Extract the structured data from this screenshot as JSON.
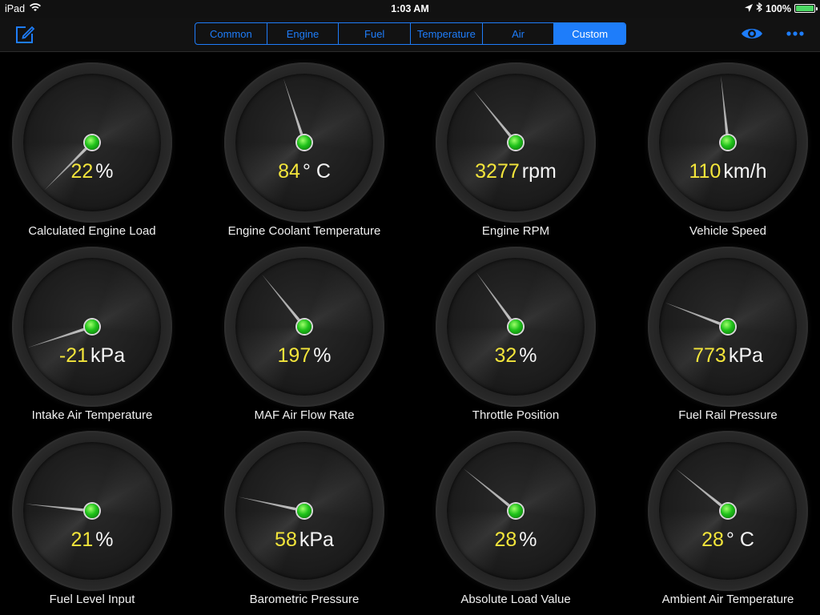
{
  "status_bar": {
    "device": "iPad",
    "time": "1:03 AM",
    "battery": "100%",
    "battery_level": 1.0,
    "icons": [
      "wifi-icon",
      "location-arrow-icon",
      "bluetooth-icon",
      "battery-icon"
    ]
  },
  "nav": {
    "left_icon": "compose-icon",
    "tabs": [
      {
        "label": "Common",
        "selected": false
      },
      {
        "label": "Engine",
        "selected": false
      },
      {
        "label": "Fuel",
        "selected": false
      },
      {
        "label": "Temperature",
        "selected": false
      },
      {
        "label": "Air",
        "selected": false
      },
      {
        "label": "Custom",
        "selected": true
      }
    ],
    "right_icons": [
      "eye-icon",
      "more-icon"
    ],
    "accent_color": "#1e7dfa"
  },
  "colors": {
    "value": "#f3e53b",
    "hub": "#1fc21a"
  },
  "gauges": [
    {
      "label": "Calculated Engine Load",
      "value": "22",
      "unit": "%",
      "needle": 0.05
    },
    {
      "label": "Engine Coolant Temperature",
      "value": "84",
      "unit": "°  C",
      "needle": 0.44
    },
    {
      "label": "Engine RPM",
      "value": "3277",
      "unit": "rpm",
      "needle": 0.37
    },
    {
      "label": "Vehicle Speed",
      "value": "110",
      "unit": "km/h",
      "needle": 0.48
    },
    {
      "label": "Intake Air Temperature",
      "value": "-21",
      "unit": "kPa",
      "needle": 0.14
    },
    {
      "label": "MAF Air Flow Rate",
      "value": "197",
      "unit": "%",
      "needle": 0.37
    },
    {
      "label": "Throttle Position",
      "value": "32",
      "unit": "%",
      "needle": 0.38
    },
    {
      "label": "Fuel Rail Pressure",
      "value": "773",
      "unit": "kPa",
      "needle": 0.27
    },
    {
      "label": "Fuel Level Input",
      "value": "21",
      "unit": "%",
      "needle": 0.22
    },
    {
      "label": "Barometric Pressure",
      "value": "58",
      "unit": "kPa",
      "needle": 0.24
    },
    {
      "label": "Absolute Load Value",
      "value": "28",
      "unit": "%",
      "needle": 0.33
    },
    {
      "label": "Ambient Air Temperature",
      "value": "28",
      "unit": "°  C",
      "needle": 0.33
    }
  ]
}
